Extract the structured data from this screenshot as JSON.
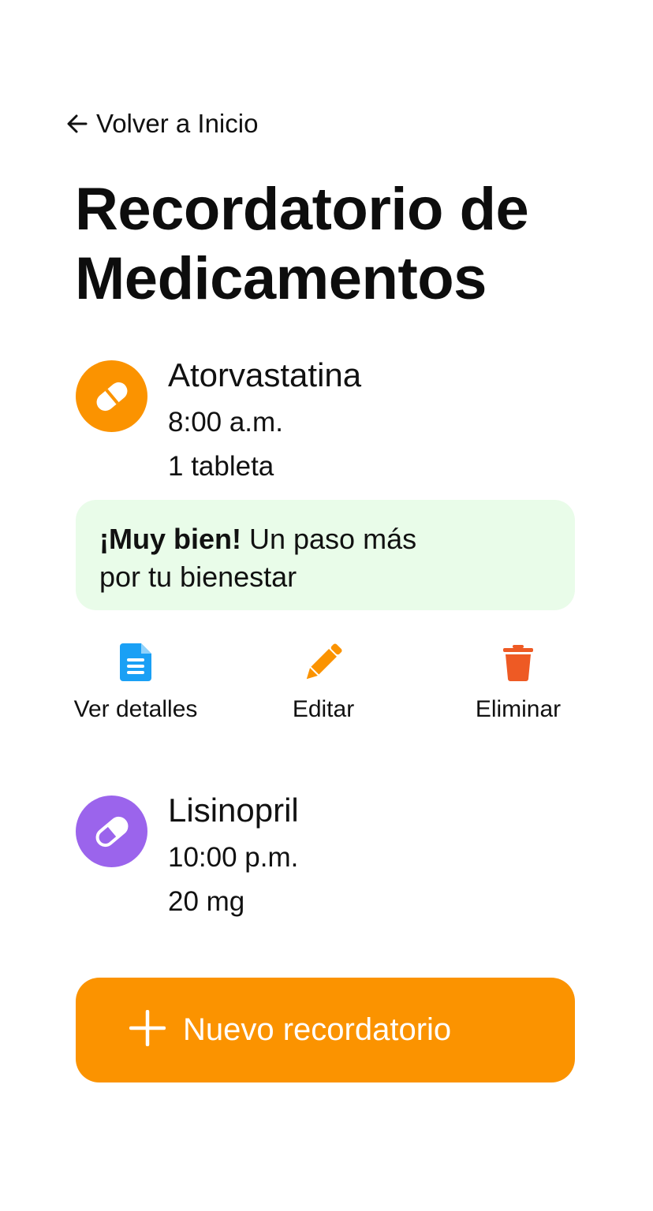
{
  "nav": {
    "back_label": "Volver a Inicio"
  },
  "page": {
    "title": "Recordatorio de Medicamentos"
  },
  "medications": [
    {
      "name": "Atorvastatina",
      "time": "8:00 a.m.",
      "dose": "1 tableta",
      "icon": "pill-icon",
      "color": "#fb9300"
    },
    {
      "name": "Lisinopril",
      "time": "10:00 p.m.",
      "dose": "20 mg",
      "icon": "pill-icon",
      "color": "#9b64ec"
    }
  ],
  "encouragement": {
    "strong": "¡Muy bien!",
    "line1_rest": " Un paso más",
    "line2": "por tu bienestar",
    "background": "#e9fce9"
  },
  "actions": {
    "details": {
      "label": "Ver detalles",
      "icon": "document-icon",
      "color": "#1aa0f5"
    },
    "edit": {
      "label": "Editar",
      "icon": "pencil-icon",
      "color": "#fb9300"
    },
    "delete": {
      "label": "Eliminar",
      "icon": "trash-icon",
      "color": "#ee5a24"
    }
  },
  "new_reminder": {
    "label": "Nuevo recordatorio",
    "icon": "plus-icon",
    "color": "#fb9300"
  }
}
